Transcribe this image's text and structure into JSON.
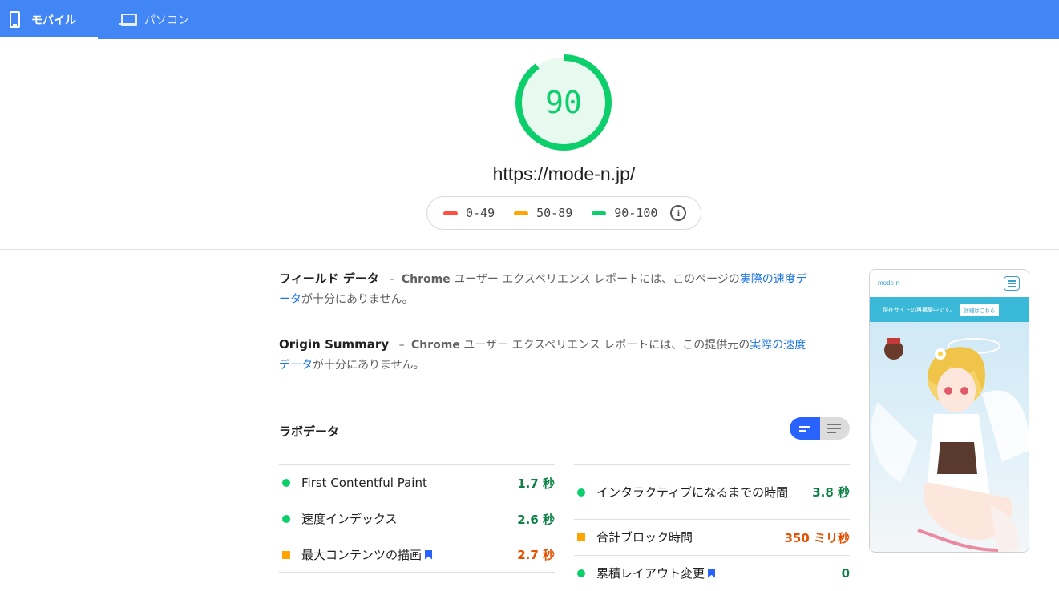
{
  "tabs": {
    "mobile_label": "モバイル",
    "desktop_label": "パソコン"
  },
  "score": {
    "value": "90",
    "fraction": 0.9,
    "color": "#0cce6b",
    "url": "https://mode-n.jp/"
  },
  "legend": {
    "fail": {
      "label": "0-49",
      "color": "#ff4e42"
    },
    "average": {
      "label": "50-89",
      "color": "#ffa400"
    },
    "pass": {
      "label": "90-100",
      "color": "#0cce6b"
    },
    "info_icon": "info-icon",
    "info_glyph": "i"
  },
  "field_data": {
    "title": "フィールド データ",
    "sep": "–",
    "chrome": "Chrome",
    "text_before": " ユーザー エクスペリエンス レポートには、このページの",
    "link": "実際の速度データ",
    "text_after": "が十分にありません。"
  },
  "origin_summary": {
    "title": "Origin Summary",
    "sep": "–",
    "chrome": "Chrome",
    "text_before": " ユーザー エクスペリエンス レポートには、この提供元の",
    "link": "実際の速度データ",
    "text_after": "が十分にありません。"
  },
  "lab_data": {
    "title": "ラボデータ",
    "view_toggle": {
      "left_icon": "list-compact-icon",
      "right_icon": "list-expanded-icon"
    }
  },
  "metrics_left": [
    {
      "label": "First Contentful Paint",
      "value": "1.7 秒",
      "status": "pass",
      "bookmark": false
    },
    {
      "label": "速度インデックス",
      "value": "2.6 秒",
      "status": "pass",
      "bookmark": false
    },
    {
      "label": "最大コンテンツの描画",
      "value": "2.7 秒",
      "status": "average",
      "bookmark": true
    }
  ],
  "metrics_right": [
    {
      "label": "インタラクティブになるまでの時間",
      "value": "3.8 秒",
      "status": "pass",
      "bookmark": false
    },
    {
      "label": "合計ブロック時間",
      "value": "350 ミリ秒",
      "status": "average",
      "bookmark": false
    },
    {
      "label": "累積レイアウト変更",
      "value": "0",
      "status": "pass",
      "bookmark": true
    }
  ],
  "preview": {
    "logo": "mode-n",
    "banner_text": "現在サイトの再構築中です。",
    "banner_button": "詳細はこちら"
  },
  "colors": {
    "header": "#4285f4",
    "pass": "#0cce6b",
    "average": "#ffa400",
    "fail": "#ff4e42",
    "link": "#1a73e8"
  }
}
